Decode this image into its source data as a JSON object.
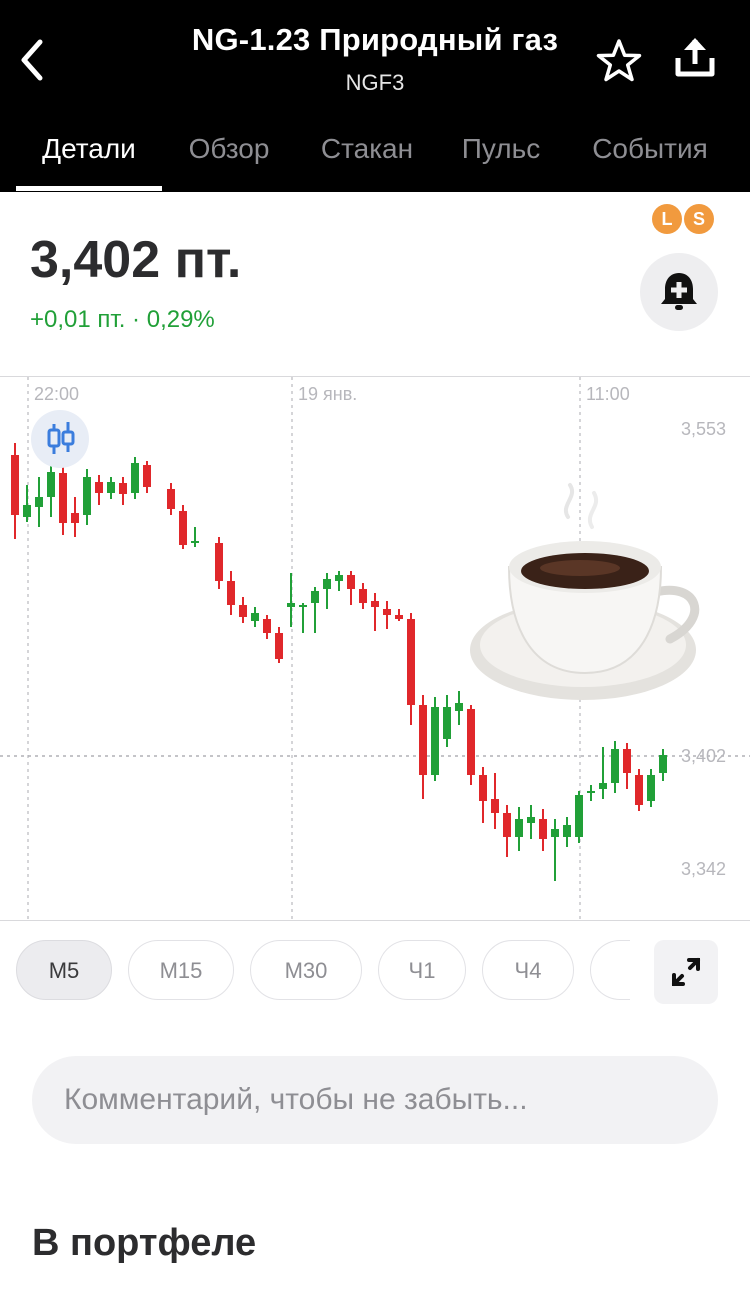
{
  "header": {
    "title": "NG-1.23 Природный газ",
    "ticker": "NGF3",
    "back_icon": "chevron-left-icon",
    "favorite_icon": "star-icon",
    "share_icon": "share-icon"
  },
  "tabs": [
    {
      "label": "Детали",
      "active": true
    },
    {
      "label": "Обзор",
      "active": false
    },
    {
      "label": "Стакан",
      "active": false
    },
    {
      "label": "Пульс",
      "active": false
    },
    {
      "label": "События",
      "active": false
    }
  ],
  "quote": {
    "price": "3,402 пт.",
    "change": "+0,01 пт. · 0,29%",
    "badges": [
      "L",
      "S"
    ],
    "alert_icon": "bell-plus-icon"
  },
  "chart": {
    "time_labels": [
      "22:00",
      "19 янв.",
      "11:00"
    ],
    "price_labels": [
      "3,553",
      "3,402",
      "3,342"
    ],
    "indicator_icon": "candlestick-icon",
    "overlay_icon": "coffee-cup-icon"
  },
  "chart_data": {
    "type": "candlestick",
    "x_labels": [
      "22:00",
      "19 янв.",
      "11:00"
    ],
    "y_ticks": [
      3.553,
      3.402,
      3.342
    ],
    "current_price": 3.402,
    "up_color": "#21a038",
    "down_color": "#e0282b"
  },
  "timeframes": [
    {
      "label": "M5",
      "active": true
    },
    {
      "label": "M15",
      "active": false
    },
    {
      "label": "M30",
      "active": false
    },
    {
      "label": "Ч1",
      "active": false
    },
    {
      "label": "Ч4",
      "active": false
    }
  ],
  "expand_icon": "expand-icon",
  "comment_placeholder": "Комментарий, чтобы не забыть...",
  "portfolio_title": "В портфеле",
  "colors": {
    "header_bg": "#000000",
    "positive": "#21a038",
    "negative": "#e0282b",
    "badge": "#f19a3e"
  }
}
